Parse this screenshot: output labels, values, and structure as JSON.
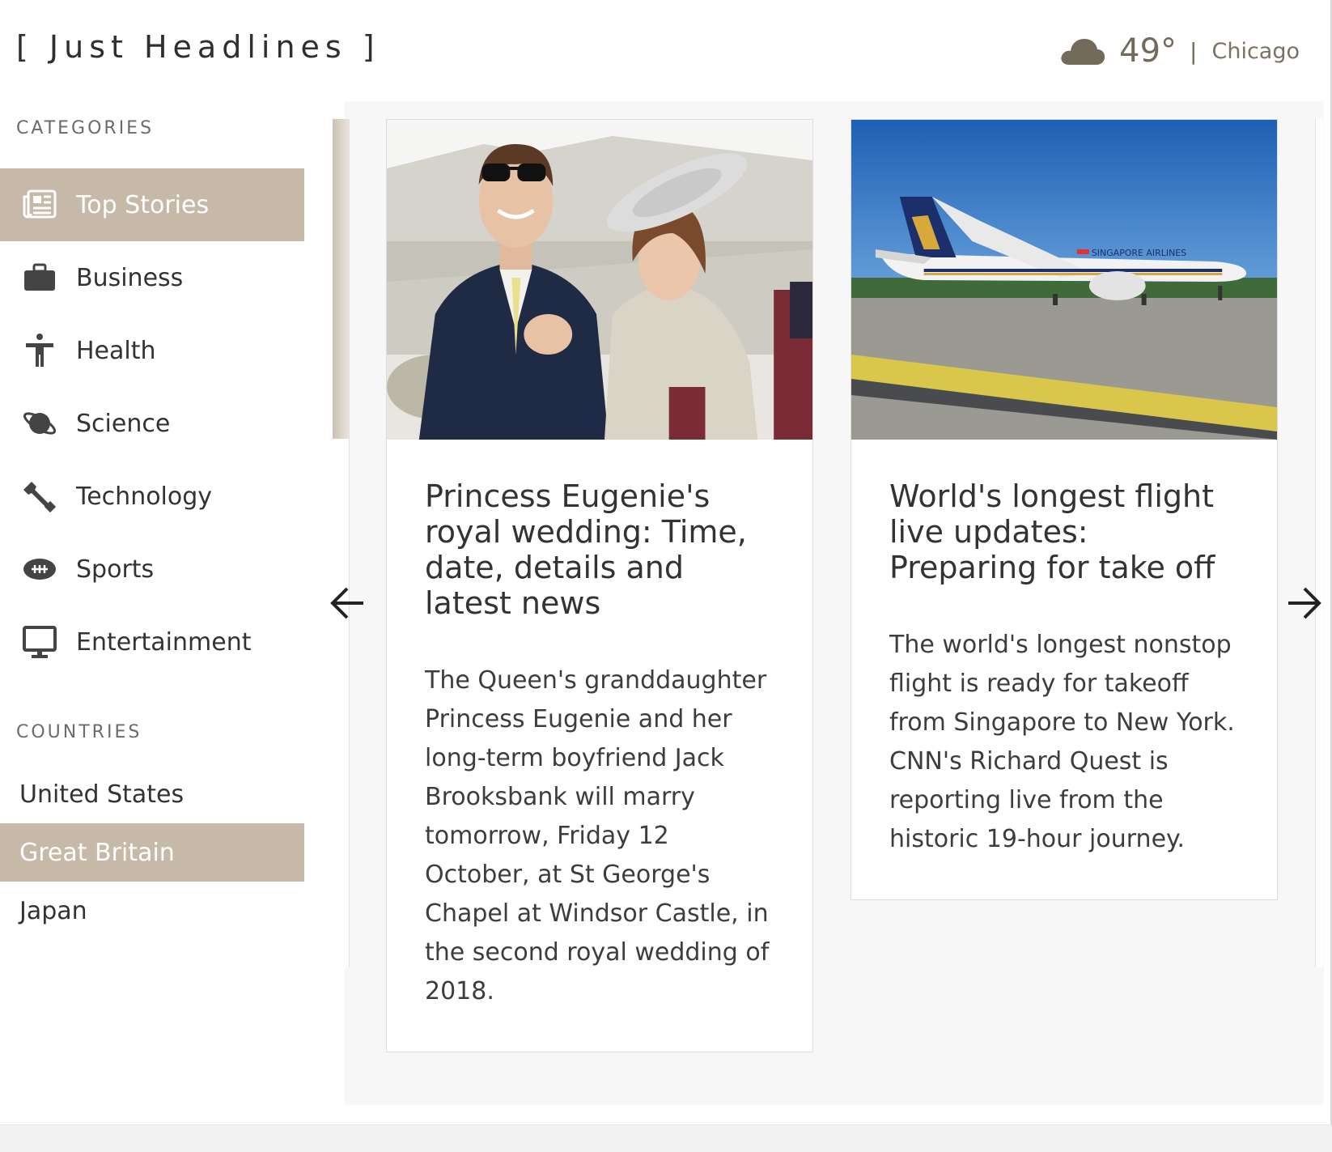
{
  "header": {
    "logo": "[ Just Headlines ]",
    "weather": {
      "icon": "cloud-icon",
      "temperature": "49°",
      "separator": "|",
      "city": "Chicago"
    }
  },
  "sidebar": {
    "categories_title": "CATEGORIES",
    "categories": [
      {
        "label": "Top Stories",
        "icon": "newspaper-icon",
        "active": true
      },
      {
        "label": "Business",
        "icon": "briefcase-icon",
        "active": false
      },
      {
        "label": "Health",
        "icon": "person-icon",
        "active": false
      },
      {
        "label": "Science",
        "icon": "planet-icon",
        "active": false
      },
      {
        "label": "Technology",
        "icon": "wrench-icon",
        "active": false
      },
      {
        "label": "Sports",
        "icon": "football-icon",
        "active": false
      },
      {
        "label": "Entertainment",
        "icon": "monitor-icon",
        "active": false
      }
    ],
    "countries_title": "COUNTRIES",
    "countries": [
      {
        "label": "United States",
        "active": false
      },
      {
        "label": "Great Britain",
        "active": true
      },
      {
        "label": "Japan",
        "active": false
      }
    ]
  },
  "articles": [
    {
      "headline": "Princess Eugenie's royal wedding: Time, date, details and latest news",
      "summary": "The Queen's granddaughter Princess Eugenie and her long-term boyfriend Jack Brooksbank will marry tomorrow, Friday 12 October, at St George's Chapel at Windsor Castle, in the second royal wedding of 2018."
    },
    {
      "headline": "World's longest flight live updates: Preparing for take off",
      "summary": "The world's longest nonstop flight is ready for takeoff from Singapore to New York. CNN's Richard Quest is reporting live from the historic 19-hour journey.",
      "photo_text": "SINGAPORE AIRLINES"
    }
  ],
  "colors": {
    "accent": "#c6b9a8",
    "weather_text": "#736a5a",
    "stage_background": "#f7f7f7"
  }
}
